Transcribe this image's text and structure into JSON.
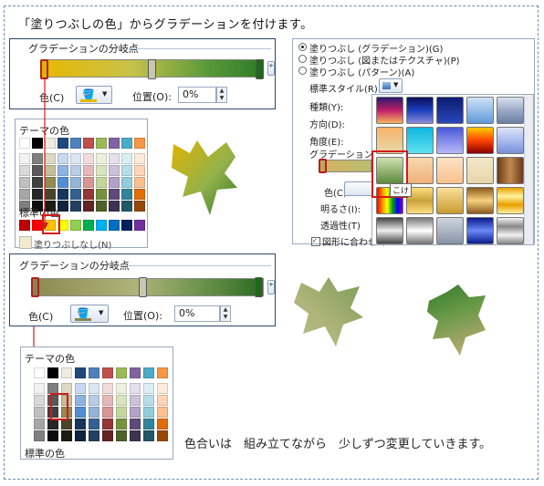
{
  "heading": "「塗りつぶしの色」からグラデーションを付けます。",
  "panel1": {
    "title": "グラデーションの分岐点",
    "color_label": "色(C)",
    "position_label": "位置(O):",
    "position_value": "0%"
  },
  "palette1": {
    "theme_title": "テーマの色",
    "standard_title": "標準の色",
    "no_fill": "塗りつぶしなし(N)"
  },
  "panel2": {
    "radio_gradient": "塗りつぶし (グラデーション)(G)",
    "radio_picture": "塗りつぶし (図またはテクスチャ)(P)",
    "radio_pattern": "塗りつぶし (パターン)(A)",
    "preset_label": "標準スタイル(R):",
    "type_label": "種類(Y):",
    "direction_label": "方向(D):",
    "angle_label": "角度(E):",
    "stops_label": "グラデーションの分岐",
    "color_label": "色(C)",
    "brightness_label": "明るさ(I):",
    "transparency_label": "透過性(T)",
    "rotate_label": "図形に合わせて",
    "tooltip": "こけ"
  },
  "panel3": {
    "title": "グラデーションの分岐点",
    "color_label": "色(C)",
    "position_label": "位置(O):",
    "position_value": "0%"
  },
  "palette2": {
    "theme_title": "テーマの色",
    "standard_title": "標準の色"
  },
  "caption": "色合いは　組み立てながら　少しずつ変更していきます。",
  "colors": {
    "accent_red": "#d21a1a",
    "frame": "#6b8fb8"
  }
}
